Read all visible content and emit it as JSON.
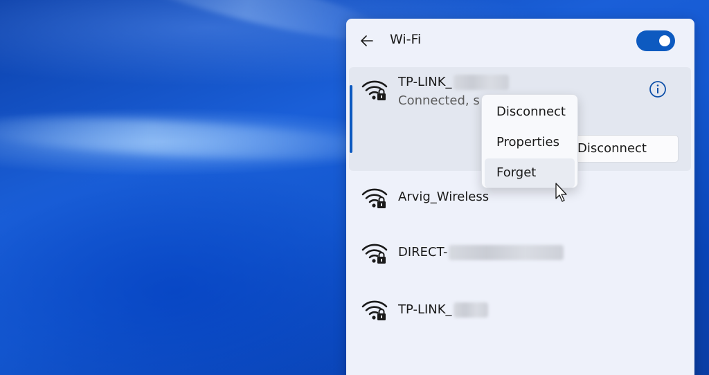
{
  "panel": {
    "title": "Wi-Fi",
    "toggle_on": true,
    "accent_color": "#0d5ac0"
  },
  "networks": [
    {
      "name": "TP-LINK_",
      "status": "Connected, s",
      "selected": true,
      "icon": "wifi-secured-icon"
    },
    {
      "name": "Arvig_Wireless",
      "icon": "wifi-secured-icon"
    },
    {
      "name": "DIRECT-",
      "icon": "wifi-secured-icon"
    },
    {
      "name": "TP-LINK_",
      "icon": "wifi-secured-icon"
    }
  ],
  "selected_actions": {
    "disconnect_label": "Disconnect",
    "info_icon": "info-icon"
  },
  "context_menu": {
    "items": [
      {
        "label": "Disconnect"
      },
      {
        "label": "Properties"
      },
      {
        "label": "Forget"
      }
    ]
  }
}
